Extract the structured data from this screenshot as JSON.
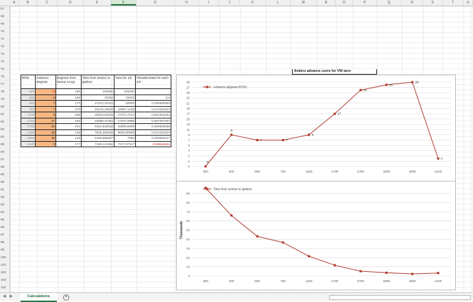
{
  "columns": [
    "A",
    "B",
    "C",
    "D",
    "E",
    "F",
    "G",
    "H",
    "I",
    "J",
    "K",
    "L",
    "M",
    "N",
    "O",
    "P",
    "Q",
    "R",
    "S",
    "T",
    "U"
  ],
  "selected_column": "F",
  "rows": [
    "67",
    "68",
    "69",
    "70",
    "71",
    "72",
    "73",
    "74",
    "75",
    "76",
    "77",
    "78",
    "79",
    "80",
    "81",
    "82",
    "83",
    "84",
    "85",
    "86",
    "87",
    "88",
    "89",
    "90",
    "91",
    "92",
    "93",
    "94",
    "95",
    "96",
    "97",
    "98",
    "99",
    "100",
    "101",
    "102",
    "103",
    "104"
  ],
  "table": {
    "headers": [
      "RPM",
      "Advance degrees",
      "Degrees from sensor to ign.",
      "Time from sensor to ignition",
      "Time for 1/2",
      "Timedecrease for each 1/2"
    ],
    "rows": [
      [
        "300",
        "-3",
        "180",
        "100000",
        "100000",
        ""
      ],
      [
        "400",
        "9",
        "168",
        "70000",
        "75000",
        "0,6"
      ],
      [
        "600",
        "7",
        "170",
        "47222,22222",
        "50000",
        "0,455555556"
      ],
      [
        "700",
        "7",
        "170",
        "40476,19048",
        "42857,1429",
        "0,472222222"
      ],
      [
        "1100",
        "9",
        "168",
        "25454,54545",
        "27272,7273",
        "0,481944444"
      ],
      [
        "1700",
        "17",
        "160",
        "15686,27451",
        "17647,0588",
        "0,507407407"
      ],
      [
        "2750",
        "26",
        "151",
        "9151,515152",
        "10909,0909",
        "0,484920635"
      ],
      [
        "3300",
        "28",
        "149",
        "7525,252525",
        "9090,90909",
        "0,447222222"
      ],
      [
        "4000",
        "29",
        "148",
        "6166,666667",
        "7500",
        "0,426984127"
      ],
      [
        "4100",
        "0",
        "177",
        "7195,121951",
        "7317,07317",
        "-2,811111111"
      ]
    ]
  },
  "title_cell": "Anders advance curve for VW aero",
  "chart_data": [
    {
      "type": "line",
      "title": "",
      "categories": [
        "300",
        "400",
        "600",
        "700",
        "1100",
        "1700",
        "2750",
        "3300",
        "4000",
        "4100"
      ],
      "series": [
        {
          "name": "Advance degrees BTDC",
          "values": [
            -3,
            9,
            7,
            7,
            9,
            17,
            26,
            28,
            29,
            0
          ]
        }
      ],
      "data_labels": [
        "-3",
        "9",
        "7",
        "7",
        "9",
        "17",
        "26",
        "28",
        "29",
        "0"
      ],
      "ylim": [
        -3,
        29
      ],
      "yticks": [
        "-3",
        "-1",
        "1",
        "3",
        "5",
        "7",
        "9",
        "11",
        "13",
        "15",
        "17",
        "19",
        "21",
        "23",
        "25",
        "27",
        "29"
      ],
      "grid": true,
      "legend": "top-left",
      "color": "#b03a2e"
    },
    {
      "type": "line",
      "title": "",
      "ylabel": "Thousands",
      "categories": [
        "300",
        "400",
        "600",
        "700",
        "1100",
        "1700",
        "2750",
        "3300",
        "4000",
        "4100"
      ],
      "series": [
        {
          "name": "Time from sensor to ignition",
          "values": [
            100,
            70,
            47.2,
            40.5,
            25.5,
            15.7,
            9.2,
            7.5,
            6.2,
            7.2
          ]
        }
      ],
      "ylim": [
        4,
        104
      ],
      "yticks": [
        "4",
        "14",
        "24",
        "34",
        "44",
        "54",
        "64",
        "74",
        "84",
        "94"
      ],
      "grid": true,
      "legend": "top-left",
      "color": "#b03a2e"
    }
  ],
  "sheet_tab": "Calculations",
  "add_sheet": "+"
}
